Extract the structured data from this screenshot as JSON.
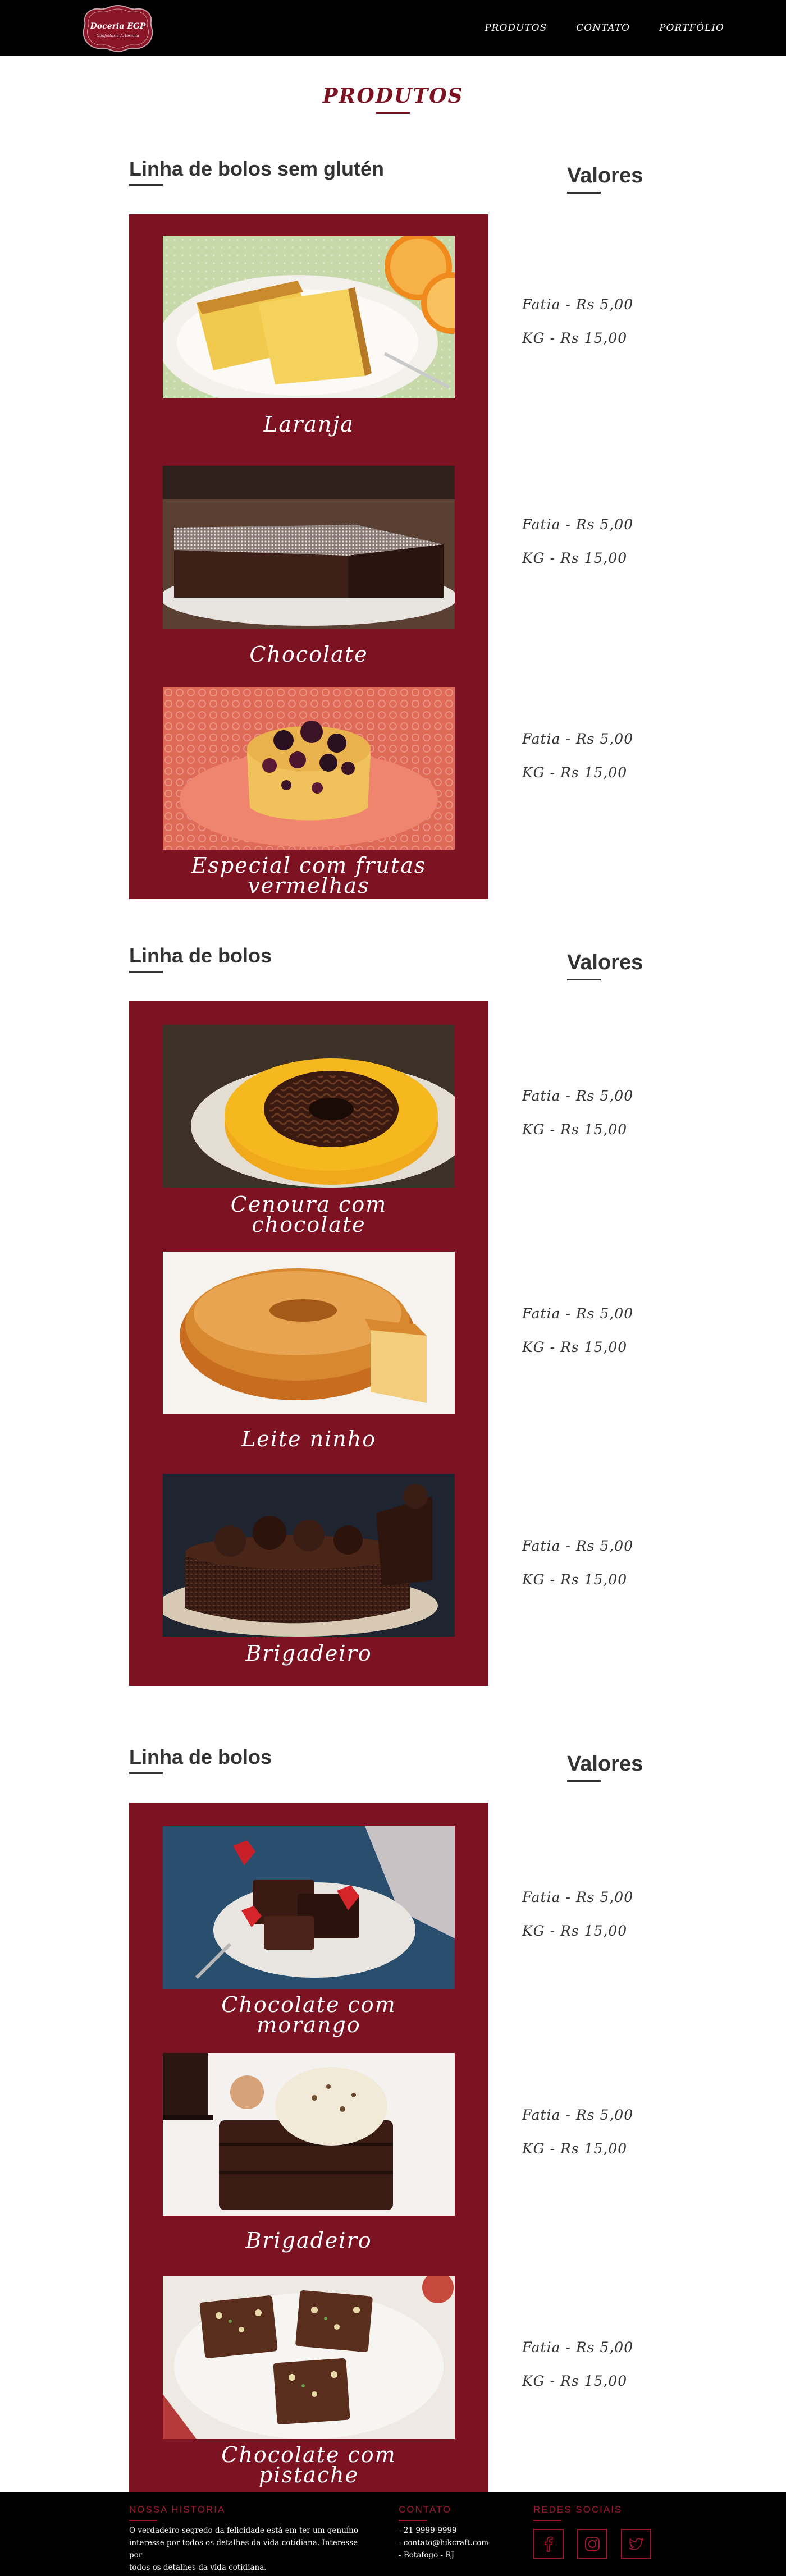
{
  "header": {
    "logo": {
      "name": "Doceria EGP",
      "tagline": "Confeitaria Artesanal"
    },
    "nav": [
      "PRODUTOS",
      "CONTATO",
      "PORTFÓLIO"
    ]
  },
  "page_title": "PRODUTOS",
  "sections": [
    {
      "heading": "Linha de bolos sem glutén",
      "values_label": "Valores",
      "items": [
        {
          "name_lines": [
            "Laranja"
          ],
          "photo": "orange-cake-photo",
          "prices": [
            "Fatia - Rs 5,00",
            "KG - Rs 15,00"
          ]
        },
        {
          "name_lines": [
            "Chocolate"
          ],
          "photo": "chocolate-cake-photo",
          "prices": [
            "Fatia - Rs 5,00",
            "KG - Rs 15,00"
          ]
        },
        {
          "name_lines": [
            "Especial com frutas",
            "vermelhas"
          ],
          "photo": "berry-cake-photo",
          "prices": [
            "Fatia - Rs 5,00",
            "KG - Rs 15,00"
          ]
        }
      ]
    },
    {
      "heading": "Linha de bolos",
      "values_label": "Valores",
      "items": [
        {
          "name_lines": [
            "Cenoura com",
            "chocolate"
          ],
          "photo": "carrot-cake-photo",
          "prices": [
            "Fatia - Rs 5,00",
            "KG - Rs 15,00"
          ]
        },
        {
          "name_lines": [
            "Leite ninho"
          ],
          "photo": "milk-cake-photo",
          "prices": [
            "Fatia - Rs 5,00",
            "KG - Rs 15,00"
          ]
        },
        {
          "name_lines": [
            "Brigadeiro"
          ],
          "photo": "brigadeiro-cake-photo",
          "prices": [
            "Fatia - Rs 5,00",
            "KG - Rs 15,00"
          ]
        }
      ]
    },
    {
      "heading": "Linha de bolos",
      "values_label": "Valores",
      "items": [
        {
          "name_lines": [
            "Chocolate com",
            "morango"
          ],
          "photo": "strawberry-brownie-photo",
          "prices": [
            "Fatia - Rs 5,00",
            "KG - Rs 15,00"
          ]
        },
        {
          "name_lines": [
            "Brigadeiro"
          ],
          "photo": "ice-cream-brownie-photo",
          "prices": [
            "Fatia - Rs 5,00",
            "KG - Rs 15,00"
          ]
        },
        {
          "name_lines": [
            "Chocolate com",
            "pistache"
          ],
          "photo": "pistachio-brownie-photo",
          "prices": [
            "Fatia - Rs 5,00",
            "KG - Rs 15,00"
          ]
        }
      ]
    }
  ],
  "footer": {
    "history": {
      "title": "NOSSA HISTORIA",
      "lines": [
        "O verdadeiro segredo da felicidade está em ter um genuíno",
        "interesse por todos os detalhes da vida cotidiana. Interesse por",
        "todos os detalhes da vida cotidiana."
      ]
    },
    "contact": {
      "title": "CONTATO",
      "items": [
        "- 21 9999-9999",
        "- contato@hikcraft.com",
        "- Botafogo - RJ"
      ]
    },
    "social": {
      "title": "REDES SOCIAIS",
      "icons": [
        "facebook-icon",
        "instagram-icon",
        "twitter-icon"
      ]
    }
  },
  "colors": {
    "brand": "#7d1223",
    "header_bg": "#000000",
    "footer_accent": "#a0182f"
  }
}
